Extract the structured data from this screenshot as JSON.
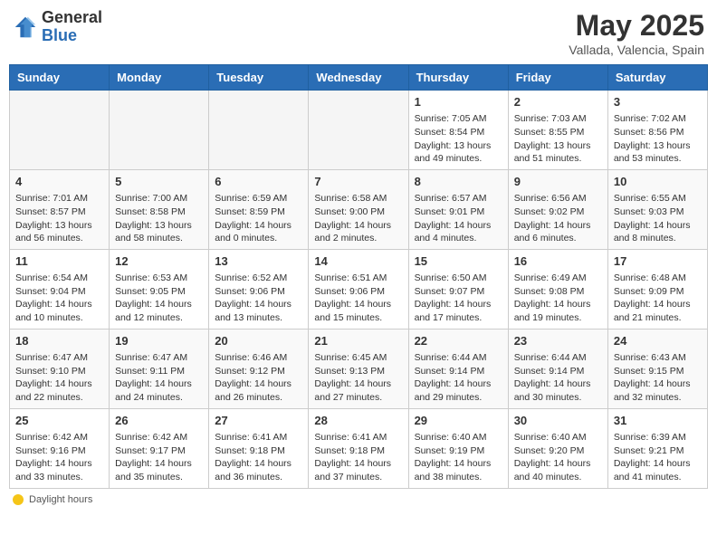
{
  "header": {
    "logo_general": "General",
    "logo_blue": "Blue",
    "month_title": "May 2025",
    "location": "Vallada, Valencia, Spain"
  },
  "weekdays": [
    "Sunday",
    "Monday",
    "Tuesday",
    "Wednesday",
    "Thursday",
    "Friday",
    "Saturday"
  ],
  "legend_label": "Daylight hours",
  "weeks": [
    [
      {
        "day": "",
        "empty": true
      },
      {
        "day": "",
        "empty": true
      },
      {
        "day": "",
        "empty": true
      },
      {
        "day": "",
        "empty": true
      },
      {
        "day": "1",
        "sunrise": "7:05 AM",
        "sunset": "8:54 PM",
        "daylight": "13 hours and 49 minutes."
      },
      {
        "day": "2",
        "sunrise": "7:03 AM",
        "sunset": "8:55 PM",
        "daylight": "13 hours and 51 minutes."
      },
      {
        "day": "3",
        "sunrise": "7:02 AM",
        "sunset": "8:56 PM",
        "daylight": "13 hours and 53 minutes."
      }
    ],
    [
      {
        "day": "4",
        "sunrise": "7:01 AM",
        "sunset": "8:57 PM",
        "daylight": "13 hours and 56 minutes."
      },
      {
        "day": "5",
        "sunrise": "7:00 AM",
        "sunset": "8:58 PM",
        "daylight": "13 hours and 58 minutes."
      },
      {
        "day": "6",
        "sunrise": "6:59 AM",
        "sunset": "8:59 PM",
        "daylight": "14 hours and 0 minutes."
      },
      {
        "day": "7",
        "sunrise": "6:58 AM",
        "sunset": "9:00 PM",
        "daylight": "14 hours and 2 minutes."
      },
      {
        "day": "8",
        "sunrise": "6:57 AM",
        "sunset": "9:01 PM",
        "daylight": "14 hours and 4 minutes."
      },
      {
        "day": "9",
        "sunrise": "6:56 AM",
        "sunset": "9:02 PM",
        "daylight": "14 hours and 6 minutes."
      },
      {
        "day": "10",
        "sunrise": "6:55 AM",
        "sunset": "9:03 PM",
        "daylight": "14 hours and 8 minutes."
      }
    ],
    [
      {
        "day": "11",
        "sunrise": "6:54 AM",
        "sunset": "9:04 PM",
        "daylight": "14 hours and 10 minutes."
      },
      {
        "day": "12",
        "sunrise": "6:53 AM",
        "sunset": "9:05 PM",
        "daylight": "14 hours and 12 minutes."
      },
      {
        "day": "13",
        "sunrise": "6:52 AM",
        "sunset": "9:06 PM",
        "daylight": "14 hours and 13 minutes."
      },
      {
        "day": "14",
        "sunrise": "6:51 AM",
        "sunset": "9:06 PM",
        "daylight": "14 hours and 15 minutes."
      },
      {
        "day": "15",
        "sunrise": "6:50 AM",
        "sunset": "9:07 PM",
        "daylight": "14 hours and 17 minutes."
      },
      {
        "day": "16",
        "sunrise": "6:49 AM",
        "sunset": "9:08 PM",
        "daylight": "14 hours and 19 minutes."
      },
      {
        "day": "17",
        "sunrise": "6:48 AM",
        "sunset": "9:09 PM",
        "daylight": "14 hours and 21 minutes."
      }
    ],
    [
      {
        "day": "18",
        "sunrise": "6:47 AM",
        "sunset": "9:10 PM",
        "daylight": "14 hours and 22 minutes."
      },
      {
        "day": "19",
        "sunrise": "6:47 AM",
        "sunset": "9:11 PM",
        "daylight": "14 hours and 24 minutes."
      },
      {
        "day": "20",
        "sunrise": "6:46 AM",
        "sunset": "9:12 PM",
        "daylight": "14 hours and 26 minutes."
      },
      {
        "day": "21",
        "sunrise": "6:45 AM",
        "sunset": "9:13 PM",
        "daylight": "14 hours and 27 minutes."
      },
      {
        "day": "22",
        "sunrise": "6:44 AM",
        "sunset": "9:14 PM",
        "daylight": "14 hours and 29 minutes."
      },
      {
        "day": "23",
        "sunrise": "6:44 AM",
        "sunset": "9:14 PM",
        "daylight": "14 hours and 30 minutes."
      },
      {
        "day": "24",
        "sunrise": "6:43 AM",
        "sunset": "9:15 PM",
        "daylight": "14 hours and 32 minutes."
      }
    ],
    [
      {
        "day": "25",
        "sunrise": "6:42 AM",
        "sunset": "9:16 PM",
        "daylight": "14 hours and 33 minutes."
      },
      {
        "day": "26",
        "sunrise": "6:42 AM",
        "sunset": "9:17 PM",
        "daylight": "14 hours and 35 minutes."
      },
      {
        "day": "27",
        "sunrise": "6:41 AM",
        "sunset": "9:18 PM",
        "daylight": "14 hours and 36 minutes."
      },
      {
        "day": "28",
        "sunrise": "6:41 AM",
        "sunset": "9:18 PM",
        "daylight": "14 hours and 37 minutes."
      },
      {
        "day": "29",
        "sunrise": "6:40 AM",
        "sunset": "9:19 PM",
        "daylight": "14 hours and 38 minutes."
      },
      {
        "day": "30",
        "sunrise": "6:40 AM",
        "sunset": "9:20 PM",
        "daylight": "14 hours and 40 minutes."
      },
      {
        "day": "31",
        "sunrise": "6:39 AM",
        "sunset": "9:21 PM",
        "daylight": "14 hours and 41 minutes."
      }
    ]
  ]
}
